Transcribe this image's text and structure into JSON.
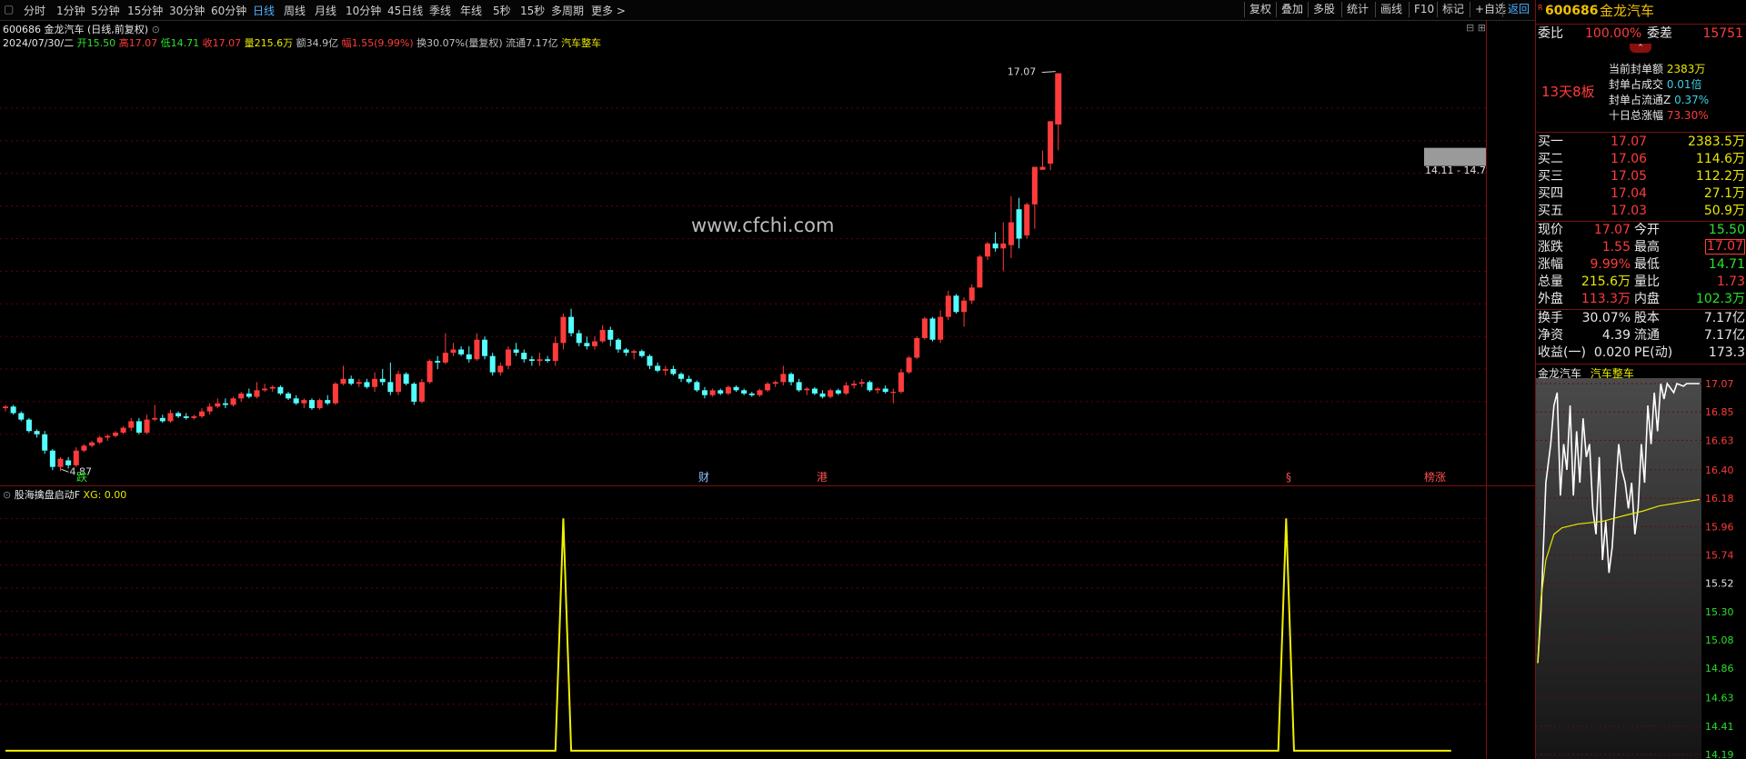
{
  "colors": {
    "up": "#ff3b3b",
    "down": "#54ffff",
    "grid": "#6a0000",
    "yellow": "#f0f000",
    "bg": "#000000"
  },
  "toolbar": {
    "periods": [
      "分时",
      "1分钟",
      "5分钟",
      "15分钟",
      "30分钟",
      "60分钟",
      "日线",
      "周线",
      "月线",
      "10分钟",
      "45日线",
      "季线",
      "年线",
      "5秒",
      "15秒",
      "多周期",
      "更多 >"
    ],
    "active": "日线",
    "buttons": [
      "复权",
      "叠加",
      "多股",
      "统计",
      "画线",
      "F10",
      "标记",
      "+自选",
      "返回"
    ]
  },
  "info": {
    "code_name": "600686 金龙汽车 (日线,前复权)",
    "date": "2024/07/30/二",
    "open": "开15.50",
    "high": "高17.07",
    "low": "低14.71",
    "close": "收17.07",
    "vol": "量215.6万",
    "amount": "额34.9亿",
    "change": "幅1.55(9.99%)",
    "turnover": "换30.07%(量复权)",
    "float": "流通7.17亿",
    "sector": "汽车整车"
  },
  "watermark": "www.cfchi.com",
  "price_annotations": {
    "high_label": "17.07",
    "low_label": "4.87",
    "range_label": "14.11 - 14.7"
  },
  "markers": [
    {
      "text": "跌"
    },
    {
      "text": "财"
    },
    {
      "text": "港"
    },
    {
      "text": "§"
    },
    {
      "text": "榜涨"
    }
  ],
  "indicator": {
    "name": "股海擒盘启动F",
    "value": "XG: 0.00"
  },
  "chart_data": [
    {
      "type": "candlestick",
      "title": "600686 金龙汽车 (日线,前复权)",
      "y_ticks": [
        "16.00",
        "15.00",
        "14.00",
        "13.00",
        "12.00",
        "11.00",
        "10.00",
        "9.00",
        "8.00",
        "7.00",
        "6.00"
      ],
      "ylim": [
        4.6,
        17.7
      ],
      "grid": true,
      "ohlc": [
        [
          6.8,
          6.9,
          6.7,
          6.85
        ],
        [
          6.85,
          6.9,
          6.6,
          6.65
        ],
        [
          6.65,
          6.7,
          6.4,
          6.45
        ],
        [
          6.45,
          6.5,
          6.05,
          6.1
        ],
        [
          6.1,
          6.15,
          5.9,
          6.0
        ],
        [
          6.0,
          6.1,
          5.4,
          5.5
        ],
        [
          5.5,
          5.55,
          4.9,
          5.0
        ],
        [
          5.0,
          5.3,
          4.87,
          5.25
        ],
        [
          5.2,
          5.3,
          4.95,
          5.05
        ],
        [
          5.05,
          5.6,
          5.0,
          5.5
        ],
        [
          5.5,
          5.7,
          5.45,
          5.65
        ],
        [
          5.65,
          5.8,
          5.6,
          5.75
        ],
        [
          5.75,
          5.95,
          5.7,
          5.9
        ],
        [
          5.9,
          6.0,
          5.8,
          5.95
        ],
        [
          5.95,
          6.1,
          5.9,
          6.05
        ],
        [
          6.05,
          6.25,
          6.0,
          6.2
        ],
        [
          6.2,
          6.5,
          6.1,
          6.4
        ],
        [
          6.4,
          6.5,
          6.0,
          6.05
        ],
        [
          6.05,
          6.6,
          6.0,
          6.45
        ],
        [
          6.45,
          6.9,
          6.4,
          6.5
        ],
        [
          6.5,
          6.6,
          6.35,
          6.4
        ],
        [
          6.4,
          6.75,
          6.35,
          6.65
        ],
        [
          6.65,
          6.7,
          6.5,
          6.55
        ],
        [
          6.55,
          6.65,
          6.45,
          6.5
        ],
        [
          6.5,
          6.6,
          6.45,
          6.55
        ],
        [
          6.55,
          6.8,
          6.5,
          6.7
        ],
        [
          6.7,
          6.95,
          6.6,
          6.85
        ],
        [
          6.85,
          7.1,
          6.8,
          6.95
        ],
        [
          6.95,
          7.1,
          6.8,
          6.9
        ],
        [
          6.9,
          7.15,
          6.85,
          7.1
        ],
        [
          7.1,
          7.3,
          7.0,
          7.25
        ],
        [
          7.25,
          7.4,
          7.1,
          7.15
        ],
        [
          7.15,
          7.6,
          7.1,
          7.35
        ],
        [
          7.35,
          7.55,
          7.3,
          7.4
        ],
        [
          7.4,
          7.5,
          7.3,
          7.45
        ],
        [
          7.45,
          7.5,
          7.2,
          7.25
        ],
        [
          7.25,
          7.3,
          7.05,
          7.1
        ],
        [
          7.1,
          7.2,
          6.9,
          6.95
        ],
        [
          6.95,
          7.1,
          6.8,
          7.05
        ],
        [
          7.05,
          7.1,
          6.75,
          6.8
        ],
        [
          6.8,
          7.1,
          6.75,
          7.05
        ],
        [
          7.05,
          7.2,
          6.9,
          6.95
        ],
        [
          6.95,
          7.6,
          6.9,
          7.55
        ],
        [
          7.55,
          8.1,
          7.5,
          7.7
        ],
        [
          7.7,
          7.8,
          7.5,
          7.55
        ],
        [
          7.55,
          7.7,
          7.45,
          7.6
        ],
        [
          7.6,
          7.7,
          7.4,
          7.45
        ],
        [
          7.45,
          7.9,
          7.3,
          7.7
        ],
        [
          7.7,
          8.0,
          7.5,
          7.6
        ],
        [
          7.6,
          8.2,
          7.2,
          7.3
        ],
        [
          7.3,
          7.95,
          7.2,
          7.85
        ],
        [
          7.85,
          7.9,
          7.5,
          7.55
        ],
        [
          7.55,
          7.6,
          6.9,
          7.0
        ],
        [
          7.0,
          7.7,
          6.95,
          7.6
        ],
        [
          7.6,
          8.3,
          7.55,
          8.25
        ],
        [
          8.25,
          8.4,
          8.0,
          8.2
        ],
        [
          8.2,
          9.1,
          8.15,
          8.5
        ],
        [
          8.5,
          8.8,
          8.4,
          8.6
        ],
        [
          8.6,
          8.7,
          8.4,
          8.45
        ],
        [
          8.45,
          8.7,
          8.2,
          8.3
        ],
        [
          8.3,
          9.1,
          8.25,
          8.9
        ],
        [
          8.9,
          9.0,
          8.3,
          8.4
        ],
        [
          8.4,
          8.5,
          7.8,
          7.9
        ],
        [
          7.9,
          8.2,
          7.8,
          8.1
        ],
        [
          8.1,
          8.7,
          8.0,
          8.6
        ],
        [
          8.6,
          8.8,
          8.4,
          8.5
        ],
        [
          8.5,
          8.6,
          8.2,
          8.3
        ],
        [
          8.3,
          8.4,
          8.1,
          8.25
        ],
        [
          8.25,
          8.5,
          8.1,
          8.3
        ],
        [
          8.3,
          8.4,
          8.2,
          8.25
        ],
        [
          8.25,
          9.0,
          8.1,
          8.8
        ],
        [
          8.8,
          9.7,
          8.6,
          9.6
        ],
        [
          9.6,
          9.85,
          9.0,
          9.1
        ],
        [
          9.1,
          9.2,
          8.7,
          8.8
        ],
        [
          8.8,
          9.0,
          8.6,
          8.7
        ],
        [
          8.7,
          9.0,
          8.6,
          8.85
        ],
        [
          8.85,
          9.35,
          8.8,
          9.2
        ],
        [
          9.2,
          9.3,
          8.7,
          8.9
        ],
        [
          8.9,
          8.95,
          8.5,
          8.6
        ],
        [
          8.6,
          8.65,
          8.4,
          8.5
        ],
        [
          8.5,
          8.6,
          8.3,
          8.55
        ],
        [
          8.55,
          8.6,
          8.35,
          8.4
        ],
        [
          8.4,
          8.45,
          8.0,
          8.1
        ],
        [
          8.1,
          8.2,
          7.9,
          7.95
        ],
        [
          7.95,
          8.1,
          7.8,
          8.0
        ],
        [
          8.0,
          8.1,
          7.8,
          7.85
        ],
        [
          7.85,
          7.9,
          7.6,
          7.7
        ],
        [
          7.7,
          7.8,
          7.55,
          7.6
        ],
        [
          7.6,
          7.65,
          7.3,
          7.35
        ],
        [
          7.35,
          7.45,
          7.1,
          7.2
        ],
        [
          7.2,
          7.4,
          7.15,
          7.35
        ],
        [
          7.35,
          7.4,
          7.2,
          7.25
        ],
        [
          7.25,
          7.5,
          7.2,
          7.45
        ],
        [
          7.45,
          7.5,
          7.3,
          7.35
        ],
        [
          7.35,
          7.4,
          7.2,
          7.25
        ],
        [
          7.25,
          7.3,
          7.15,
          7.2
        ],
        [
          7.2,
          7.4,
          7.15,
          7.35
        ],
        [
          7.35,
          7.6,
          7.3,
          7.55
        ],
        [
          7.55,
          7.65,
          7.45,
          7.6
        ],
        [
          7.6,
          8.1,
          7.5,
          7.85
        ],
        [
          7.85,
          7.9,
          7.5,
          7.6
        ],
        [
          7.6,
          7.7,
          7.3,
          7.35
        ],
        [
          7.35,
          7.45,
          7.2,
          7.4
        ],
        [
          7.4,
          7.45,
          7.2,
          7.25
        ],
        [
          7.25,
          7.35,
          7.1,
          7.15
        ],
        [
          7.15,
          7.4,
          7.1,
          7.35
        ],
        [
          7.35,
          7.4,
          7.2,
          7.25
        ],
        [
          7.25,
          7.6,
          7.2,
          7.5
        ],
        [
          7.5,
          7.65,
          7.4,
          7.55
        ],
        [
          7.55,
          7.7,
          7.45,
          7.6
        ],
        [
          7.6,
          7.65,
          7.3,
          7.35
        ],
        [
          7.35,
          7.45,
          7.25,
          7.4
        ],
        [
          7.4,
          7.5,
          7.25,
          7.3
        ],
        [
          7.3,
          7.4,
          6.95,
          7.3
        ],
        [
          7.3,
          8.0,
          7.25,
          7.9
        ],
        [
          7.9,
          8.4,
          7.85,
          8.35
        ],
        [
          8.35,
          9.0,
          8.3,
          8.95
        ],
        [
          8.95,
          9.6,
          8.9,
          9.55
        ],
        [
          9.55,
          9.6,
          8.85,
          8.9
        ],
        [
          8.9,
          9.8,
          8.8,
          9.6
        ],
        [
          9.6,
          10.4,
          9.5,
          10.25
        ],
        [
          10.25,
          10.3,
          9.7,
          9.75
        ],
        [
          9.75,
          10.2,
          9.3,
          10.1
        ],
        [
          10.1,
          10.6,
          10.0,
          10.5
        ],
        [
          10.5,
          11.5,
          10.5,
          11.45
        ],
        [
          11.45,
          11.9,
          11.35,
          11.85
        ],
        [
          11.85,
          12.2,
          11.6,
          11.7
        ],
        [
          11.7,
          12.5,
          11.0,
          11.85
        ],
        [
          11.8,
          13.3,
          11.4,
          12.5
        ],
        [
          12.9,
          13.25,
          11.7,
          12.0
        ],
        [
          12.1,
          13.1,
          12.0,
          13.05
        ],
        [
          13.05,
          14.2,
          12.3,
          14.2
        ],
        [
          14.11,
          14.7,
          14.11,
          14.2
        ],
        [
          14.3,
          15.6,
          14.1,
          15.6
        ],
        [
          15.5,
          17.07,
          14.71,
          17.07
        ]
      ]
    },
    {
      "type": "line",
      "title": "股海擒盘启动F",
      "series": [
        {
          "name": "XG",
          "points": [
            [
              0,
              0
            ],
            [
              70,
              0
            ],
            [
              71,
              1
            ],
            [
              72,
              0
            ],
            [
              162,
              0
            ],
            [
              163,
              1
            ],
            [
              164,
              0
            ],
            [
              184,
              0
            ]
          ]
        }
      ],
      "y_ticks": [
        "1.00",
        "0.90",
        "0.80",
        "0.70",
        "0.60",
        "0.50",
        "0.40",
        "0.30",
        "0.20"
      ],
      "ylim": [
        -0.02,
        1.06
      ]
    },
    {
      "type": "line",
      "title": "金龙汽车 汽车整车",
      "y_ticks": [
        "17.07",
        "16.85",
        "16.63",
        "16.40",
        "16.18",
        "15.96",
        "15.74",
        "15.52",
        "15.30",
        "15.08",
        "14.86",
        "14.63",
        "14.41",
        "14.19"
      ],
      "ylim": [
        14.19,
        17.07
      ],
      "series": [
        {
          "name": "price",
          "points": [
            [
              0,
              14.9
            ],
            [
              2,
              15.3
            ],
            [
              5,
              16.3
            ],
            [
              8,
              16.6
            ],
            [
              10,
              16.9
            ],
            [
              12,
              17.0
            ],
            [
              14,
              16.2
            ],
            [
              16,
              16.6
            ],
            [
              18,
              16.4
            ],
            [
              20,
              16.9
            ],
            [
              22,
              16.2
            ],
            [
              24,
              16.7
            ],
            [
              26,
              16.3
            ],
            [
              28,
              16.8
            ],
            [
              30,
              16.5
            ],
            [
              32,
              16.6
            ],
            [
              34,
              16.1
            ],
            [
              36,
              15.9
            ],
            [
              38,
              16.5
            ],
            [
              40,
              15.7
            ],
            [
              42,
              16.0
            ],
            [
              44,
              15.6
            ],
            [
              46,
              15.8
            ],
            [
              48,
              16.2
            ],
            [
              50,
              16.6
            ],
            [
              52,
              16.4
            ],
            [
              54,
              16.3
            ],
            [
              56,
              16.1
            ],
            [
              58,
              16.3
            ],
            [
              60,
              15.9
            ],
            [
              62,
              16.1
            ],
            [
              64,
              16.6
            ],
            [
              66,
              16.3
            ],
            [
              68,
              16.9
            ],
            [
              70,
              16.6
            ],
            [
              72,
              17.0
            ],
            [
              74,
              16.7
            ],
            [
              76,
              17.07
            ],
            [
              78,
              16.95
            ],
            [
              80,
              17.07
            ],
            [
              84,
              17.0
            ],
            [
              86,
              17.07
            ],
            [
              90,
              17.05
            ],
            [
              92,
              17.07
            ],
            [
              100,
              17.07
            ]
          ]
        },
        {
          "name": "avg",
          "points": [
            [
              0,
              14.9
            ],
            [
              2,
              15.4
            ],
            [
              5,
              15.7
            ],
            [
              10,
              15.9
            ],
            [
              15,
              15.95
            ],
            [
              25,
              15.98
            ],
            [
              40,
              16.0
            ],
            [
              55,
              16.05
            ],
            [
              65,
              16.08
            ],
            [
              75,
              16.12
            ],
            [
              90,
              16.15
            ],
            [
              100,
              16.17
            ]
          ]
        }
      ]
    }
  ],
  "rpanel": {
    "stock_code": "600686",
    "stock_name": "金龙汽车",
    "weibi_label": "委比",
    "weibi": "100.00%",
    "weicha_label": "委差",
    "weicha": "15751",
    "streak": "13天8板",
    "seal": [
      {
        "label": "当前封单额",
        "value": "2383万"
      },
      {
        "label": "封单占成交",
        "value": "0.01倍"
      },
      {
        "label": "封单占流通Z",
        "value": "0.37%"
      },
      {
        "label": "十日总涨幅",
        "value": "73.30%"
      }
    ],
    "bids": [
      {
        "label": "买一",
        "price": "17.07",
        "vol": "2383.5万"
      },
      {
        "label": "买二",
        "price": "17.06",
        "vol": "114.6万"
      },
      {
        "label": "买三",
        "price": "17.05",
        "vol": "112.2万"
      },
      {
        "label": "买四",
        "price": "17.04",
        "vol": "27.1万"
      },
      {
        "label": "买五",
        "price": "17.03",
        "vol": "50.9万"
      }
    ],
    "quote": [
      {
        "l1": "现价",
        "v1": "17.07",
        "l2": "今开",
        "v2": "15.50"
      },
      {
        "l1": "涨跌",
        "v1": "1.55",
        "l2": "最高",
        "v2": "17.07"
      },
      {
        "l1": "涨幅",
        "v1": "9.99%",
        "l2": "最低",
        "v2": "14.71"
      },
      {
        "l1": "总量",
        "v1": "215.6万",
        "l2": "量比",
        "v2": "1.73"
      },
      {
        "l1": "外盘",
        "v1": "113.3万",
        "l2": "内盘",
        "v2": "102.3万"
      }
    ],
    "fund": [
      {
        "l1": "换手",
        "v1": "30.07%",
        "l2": "股本",
        "v2": "7.17亿"
      },
      {
        "l1": "净资",
        "v1": "4.39",
        "l2": "流通",
        "v2": "7.17亿"
      },
      {
        "l1": "收益(一)",
        "v1": "0.020",
        "l2": "PE(动)",
        "v2": "173.3"
      }
    ],
    "mini_title": "金龙汽车",
    "mini_sector": "汽车整车"
  }
}
